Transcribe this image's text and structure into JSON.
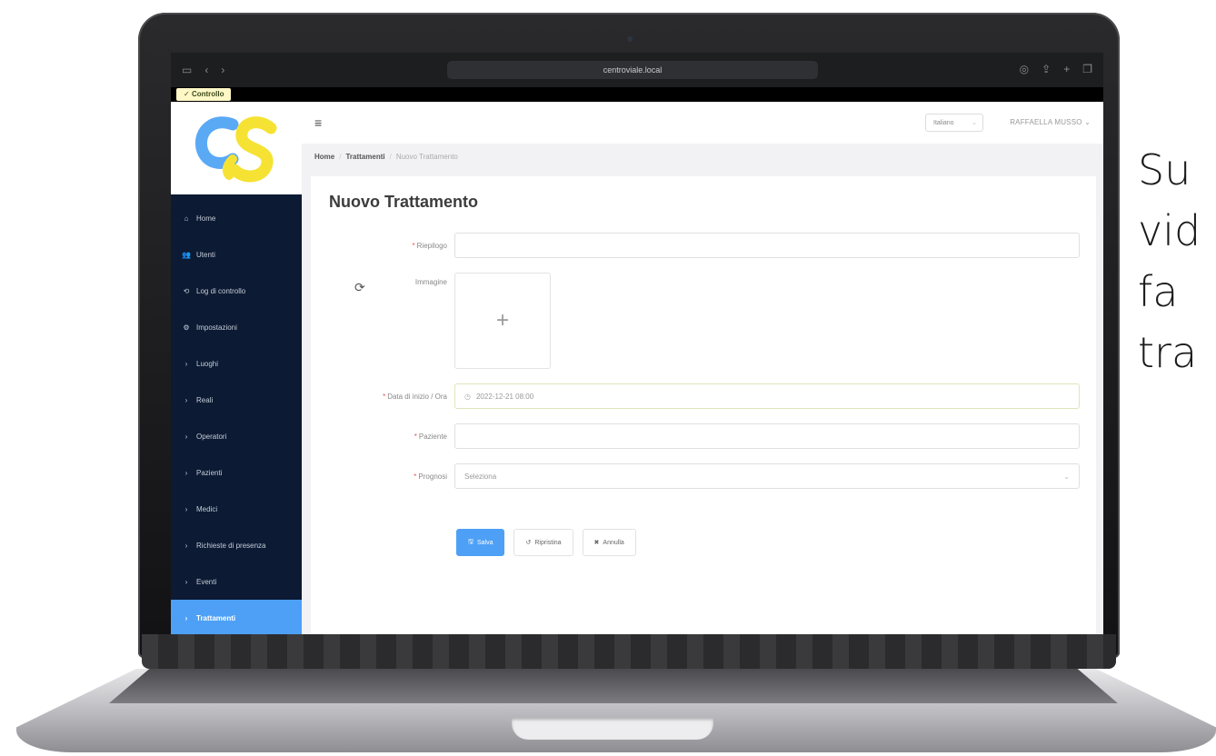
{
  "browser": {
    "url": "centroviale.local",
    "tab_label": "Controllo"
  },
  "header": {
    "language": "Italiano",
    "user": "RAFFAELLA MUSSO"
  },
  "breadcrumb": {
    "home": "Home",
    "section": "Trattamenti",
    "current": "Nuovo Trattamento"
  },
  "sidebar": {
    "items": [
      {
        "label": "Home",
        "icon": "home-icon",
        "glyph": "⌂"
      },
      {
        "label": "Utenti",
        "icon": "users-icon",
        "glyph": "👥"
      },
      {
        "label": "Log di controllo",
        "icon": "log-icon",
        "glyph": "⟲"
      },
      {
        "label": "Impostazioni",
        "icon": "gear-icon",
        "glyph": "⚙"
      },
      {
        "label": "Luoghi",
        "icon": "chevron-right-icon",
        "glyph": "›"
      },
      {
        "label": "Reali",
        "icon": "chevron-right-icon",
        "glyph": "›"
      },
      {
        "label": "Operatori",
        "icon": "chevron-right-icon",
        "glyph": "›"
      },
      {
        "label": "Pazienti",
        "icon": "chevron-right-icon",
        "glyph": "›"
      },
      {
        "label": "Medici",
        "icon": "chevron-right-icon",
        "glyph": "›"
      },
      {
        "label": "Richieste di presenza",
        "icon": "chevron-right-icon",
        "glyph": "›"
      },
      {
        "label": "Eventi",
        "icon": "chevron-right-icon",
        "glyph": "›"
      },
      {
        "label": "Trattamenti",
        "icon": "chevron-right-icon",
        "glyph": "›"
      }
    ]
  },
  "form": {
    "title": "Nuovo Trattamento",
    "riepilogo_label": "Riepilogo",
    "immagine_label": "Immagine",
    "upload_glyph": "+",
    "datetime_label": "Data di inizio / Ora",
    "datetime_value": "2022-12-21 08:00",
    "paziente_label": "Paziente",
    "prognosi_label": "Prognosi",
    "prognosi_placeholder": "Seleziona"
  },
  "buttons": {
    "save": "Salva",
    "reset": "Ripristina",
    "cancel": "Annulla"
  },
  "caption": {
    "line1": "Su",
    "line2": "vid",
    "line3": "fa",
    "line4": "tra"
  },
  "colors": {
    "sidebar_bg": "#0c1a33",
    "accent": "#4da0f6",
    "logo_blue": "#5aa9f5",
    "logo_yellow": "#f6e233"
  }
}
